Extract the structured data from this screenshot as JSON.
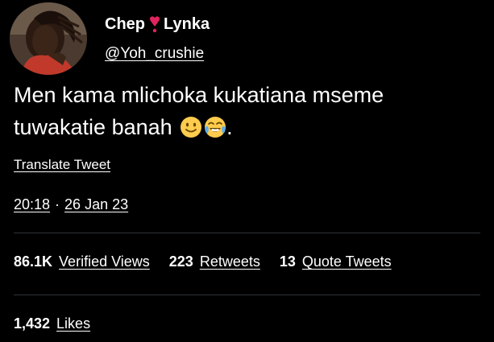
{
  "author": {
    "display_name_part1": "Chep",
    "display_name_part2": "Lynka",
    "handle": "@Yoh_crushie"
  },
  "tweet": {
    "text_line1": "Men kama mlichoka kukatiana mseme",
    "text_line2": "tuwakatie banah",
    "text_end": ".",
    "emojis": [
      "slightly-smiling-face-icon",
      "face-with-tears-of-joy-icon"
    ]
  },
  "translate_label": "Translate Tweet",
  "timestamp": {
    "time": "20:18",
    "separator": "·",
    "date": "26 Jan 23"
  },
  "stats": {
    "views_count": "86.1K",
    "views_label": "Verified Views",
    "retweets_count": "223",
    "retweets_label": "Retweets",
    "quotes_count": "13",
    "quotes_label": "Quote Tweets",
    "likes_count": "1,432",
    "likes_label": "Likes"
  },
  "colors": {
    "background": "#000000",
    "text": "#ffffff",
    "divider": "#2f3336",
    "heart": "#e0245e"
  }
}
